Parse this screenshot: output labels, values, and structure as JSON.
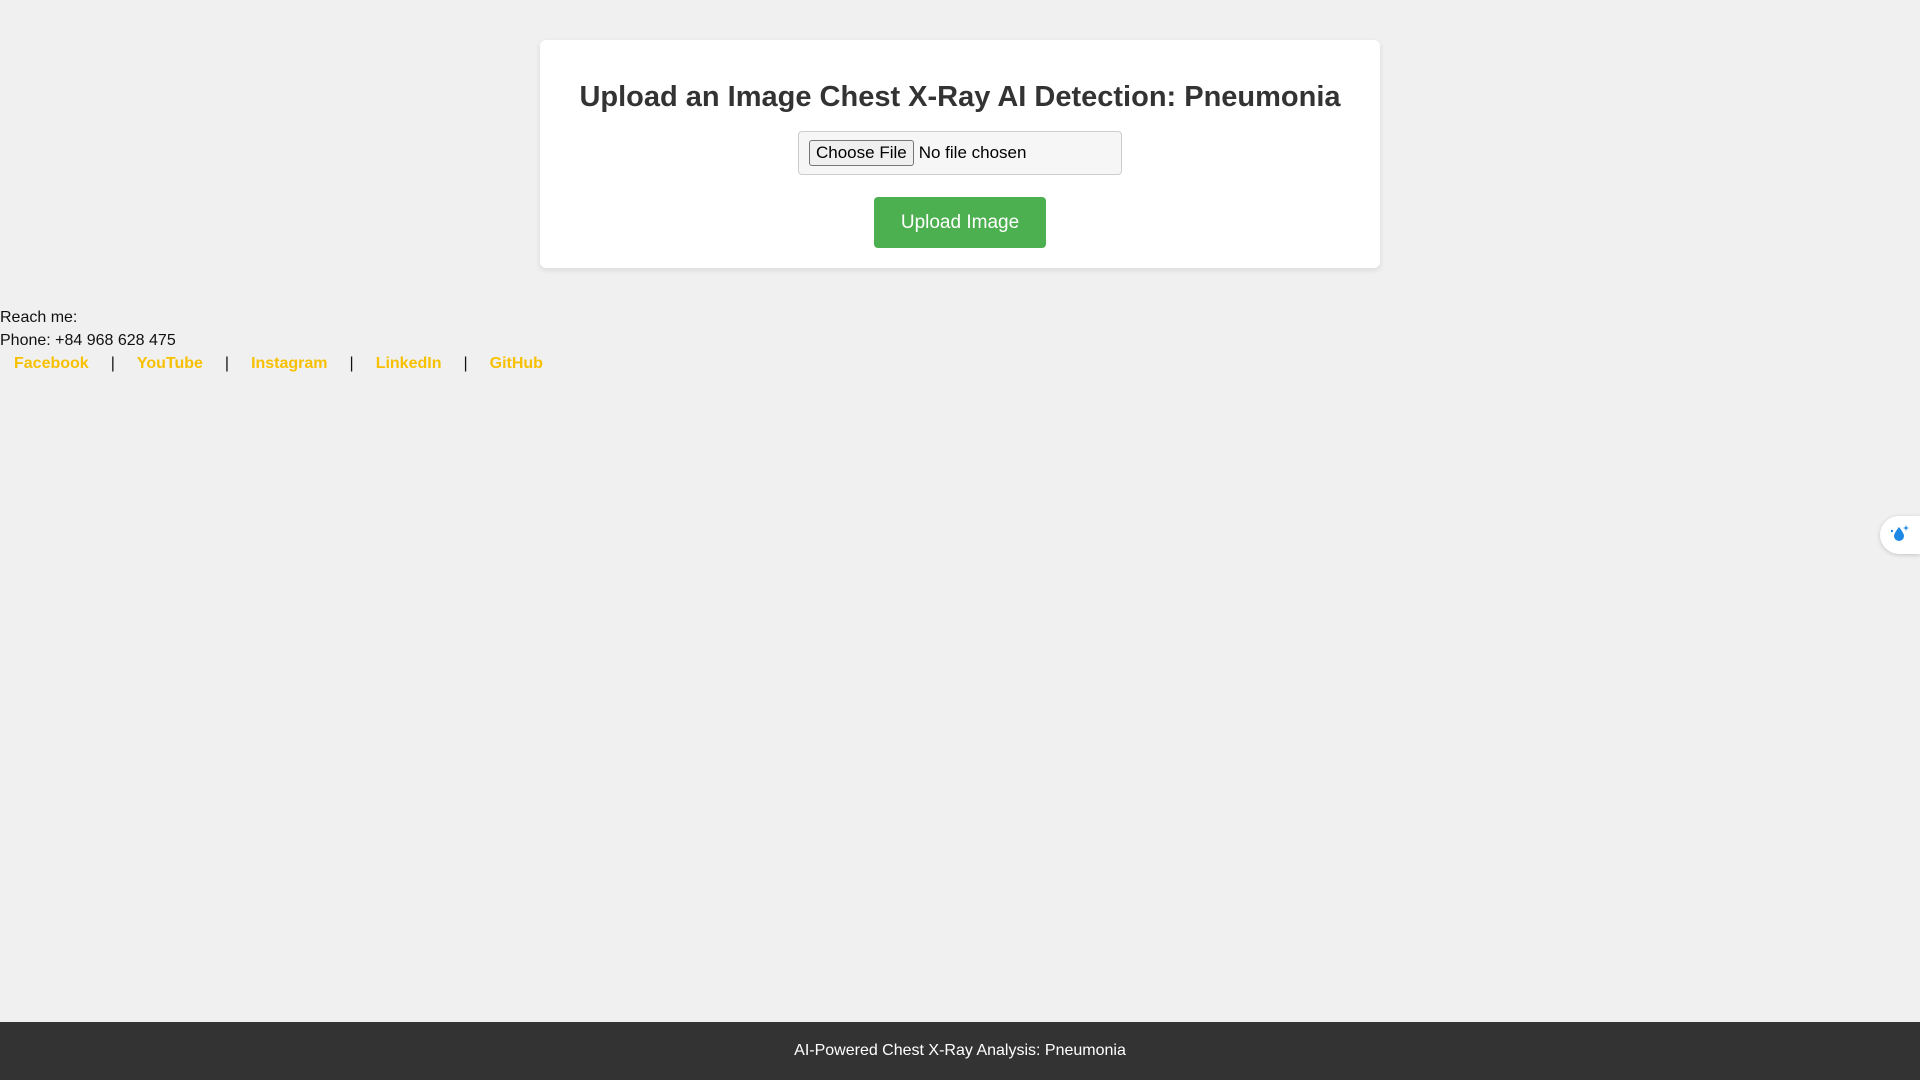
{
  "upload_card": {
    "title": "Upload an Image Chest X-Ray AI Detection: Pneumonia",
    "choose_file_label": "Choose File",
    "file_status": "No file chosen",
    "upload_button_label": "Upload Image"
  },
  "contact": {
    "reach_label": "Reach me:",
    "phone_line": "Phone: +84 968 628 475",
    "separator": "|",
    "links": [
      {
        "label": "Facebook"
      },
      {
        "label": "YouTube"
      },
      {
        "label": "Instagram"
      },
      {
        "label": "LinkedIn"
      },
      {
        "label": "GitHub"
      }
    ]
  },
  "footer": {
    "text": "AI-Powered Chest X-Ray Analysis: Pneumonia"
  },
  "side_widget": {
    "icon": "water-drop-sparkle-icon"
  },
  "colors": {
    "background": "#f0f0f0",
    "card": "#ffffff",
    "upload_button": "#4caf50",
    "link": "#f7c000",
    "footer": "#333333"
  }
}
